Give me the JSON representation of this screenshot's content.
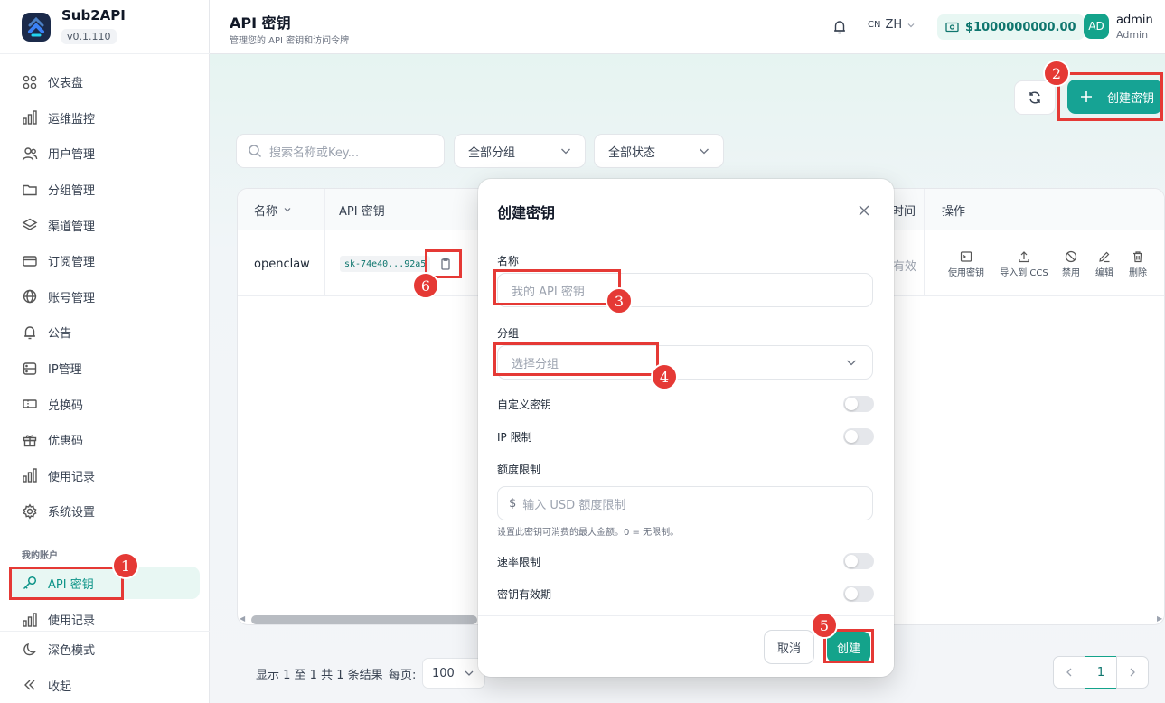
{
  "brand": {
    "name": "Sub2API",
    "version": "v0.1.110"
  },
  "sidebar": {
    "items": [
      {
        "label": "仪表盘",
        "icon": "grid-icon"
      },
      {
        "label": "运维监控",
        "icon": "bar-chart-icon"
      },
      {
        "label": "用户管理",
        "icon": "users-icon"
      },
      {
        "label": "分组管理",
        "icon": "folder-icon"
      },
      {
        "label": "渠道管理",
        "icon": "layers-icon"
      },
      {
        "label": "订阅管理",
        "icon": "credit-card-icon"
      },
      {
        "label": "账号管理",
        "icon": "globe-icon"
      },
      {
        "label": "公告",
        "icon": "bell-icon"
      },
      {
        "label": "IP管理",
        "icon": "server-icon"
      },
      {
        "label": "兑换码",
        "icon": "ticket-icon"
      },
      {
        "label": "优惠码",
        "icon": "gift-icon"
      },
      {
        "label": "使用记录",
        "icon": "bar-chart-icon"
      },
      {
        "label": "系统设置",
        "icon": "gear-icon"
      }
    ],
    "section_label": "我的账户",
    "active_item": "API 密钥",
    "after_item": "使用记录",
    "dark_mode": "深色模式",
    "collapse": "收起"
  },
  "header": {
    "title": "API 密钥",
    "subtitle": "管理您的 API 密钥和访问令牌",
    "lang_flag": "CN",
    "lang": "ZH",
    "balance": "$1000000000.00",
    "avatar": "AD",
    "user_name": "admin",
    "user_role": "Admin"
  },
  "toolbar": {
    "create_label": "创建密钥",
    "search_placeholder": "搜索名称或Key...",
    "group_filter": "全部分组",
    "status_filter": "全部状态"
  },
  "table": {
    "headers": [
      "名称",
      "API 密钥",
      "时间",
      "操作"
    ],
    "rows": [
      {
        "name": "openclaw",
        "key": "sk-74e40...92a5",
        "status": "有效"
      }
    ],
    "actions": [
      "使用密钥",
      "导入到 CCS",
      "禁用",
      "编辑",
      "删除"
    ]
  },
  "pagination": {
    "info": "显示 1 至 1 共 1 条结果",
    "per_page_label": "每页:",
    "per_page": "100",
    "current_page": "1"
  },
  "modal": {
    "title": "创建密钥",
    "name_label": "名称",
    "name_placeholder": "我的 API 密钥",
    "group_label": "分组",
    "group_placeholder": "选择分组",
    "custom_key_label": "自定义密钥",
    "ip_limit_label": "IP 限制",
    "quota_label": "额度限制",
    "quota_prefix": "$",
    "quota_placeholder": "输入 USD 额度限制",
    "quota_hint": "设置此密钥可消费的最大金额。0 = 无限制。",
    "rate_limit_label": "速率限制",
    "expiry_label": "密钥有效期",
    "cancel_label": "取消",
    "create_label": "创建"
  },
  "annotations": [
    "1",
    "2",
    "3",
    "4",
    "5",
    "6"
  ],
  "colors": {
    "accent": "#14a38b",
    "annotation": "#e53935"
  }
}
